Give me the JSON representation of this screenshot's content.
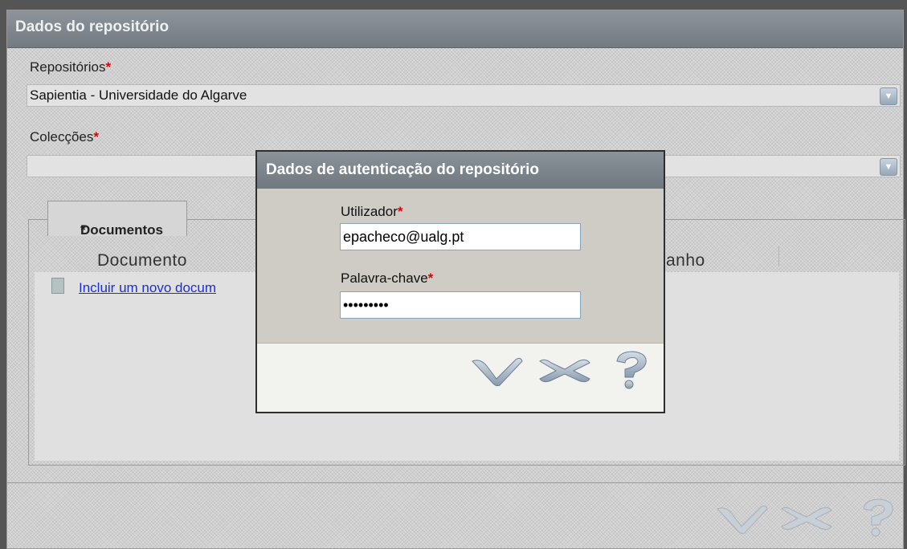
{
  "panel": {
    "title": "Dados do repositório",
    "repositorios_label": "Repositórios",
    "repositorios_value": "Sapientia - Universidade do Algarve",
    "coleccoes_label": "Colecções",
    "coleccoes_value": "",
    "required_mark": "*"
  },
  "documents": {
    "tab_label": "Documentos",
    "col_documento": "Documento",
    "col_tamanho": "anho",
    "add_link": "Incluir um novo docum"
  },
  "modal": {
    "title": "Dados de autenticação do repositório",
    "user_label": "Utilizador",
    "user_value": "epacheco@ualg.pt",
    "password_label": "Palavra-chave",
    "password_value": "•••••••••"
  },
  "icons": {
    "confirm": "checkmark-icon",
    "cancel": "close-icon",
    "help": "help-icon"
  },
  "colors": {
    "accent_title": "#7f868e",
    "required": "#e00000",
    "link": "#1a2fd8"
  }
}
